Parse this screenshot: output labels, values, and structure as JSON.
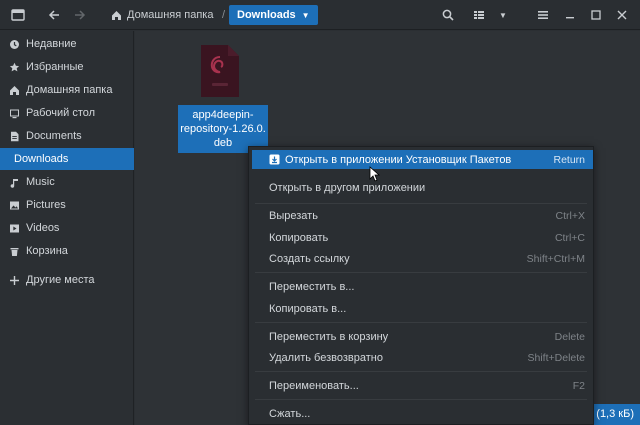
{
  "header": {
    "path_home": "Домашняя папка",
    "path_separator": "/",
    "path_current": "Downloads",
    "icons": [
      "app-icon",
      "back-arrow-icon",
      "forward-arrow-icon",
      "home-icon",
      "search-icon",
      "view-options-icon",
      "dropdown-icon",
      "menu-icon",
      "minimize-icon",
      "maximize-icon",
      "close-icon"
    ]
  },
  "sidebar": {
    "items": [
      {
        "label": "Недавние",
        "icon": "clock-icon"
      },
      {
        "label": "Избранные",
        "icon": "star-icon"
      },
      {
        "label": "Домашняя папка",
        "icon": "home-icon"
      },
      {
        "label": "Рабочий стол",
        "icon": "desktop-icon"
      },
      {
        "label": "Documents",
        "icon": "document-icon"
      },
      {
        "label": "Downloads",
        "icon": "download-icon"
      },
      {
        "label": "Music",
        "icon": "music-icon"
      },
      {
        "label": "Pictures",
        "icon": "picture-icon"
      },
      {
        "label": "Videos",
        "icon": "video-icon"
      },
      {
        "label": "Корзина",
        "icon": "trash-icon"
      },
      {
        "label": "Другие места",
        "icon": "plus-icon"
      }
    ]
  },
  "file": {
    "name": "app4deepin-repository-1.26.0.deb",
    "name_lines": [
      "app4deepin-",
      "repository-1.26.0.",
      "deb"
    ],
    "icon": "debian-package-icon"
  },
  "context_menu": {
    "items": [
      {
        "label": "Открыть в приложении Установщик Пакетов",
        "accel": "Return"
      },
      {
        "label": "Открыть в другом приложении",
        "accel": ""
      },
      {
        "label": "Вырезать",
        "accel": "Ctrl+X"
      },
      {
        "label": "Копировать",
        "accel": "Ctrl+C"
      },
      {
        "label": "Создать ссылку",
        "accel": "Shift+Ctrl+M"
      },
      {
        "label": "Переместить в...",
        "accel": ""
      },
      {
        "label": "Копировать в...",
        "accel": ""
      },
      {
        "label": "Переместить в корзину",
        "accel": "Delete"
      },
      {
        "label": "Удалить безвозвратно",
        "accel": "Shift+Delete"
      },
      {
        "label": "Переименовать...",
        "accel": "F2"
      },
      {
        "label": "Сжать...",
        "accel": ""
      }
    ]
  },
  "status": {
    "text": "(1,3 кБ)"
  },
  "colors": {
    "accent": "#1d6fb8",
    "background": "#2b2f33"
  }
}
